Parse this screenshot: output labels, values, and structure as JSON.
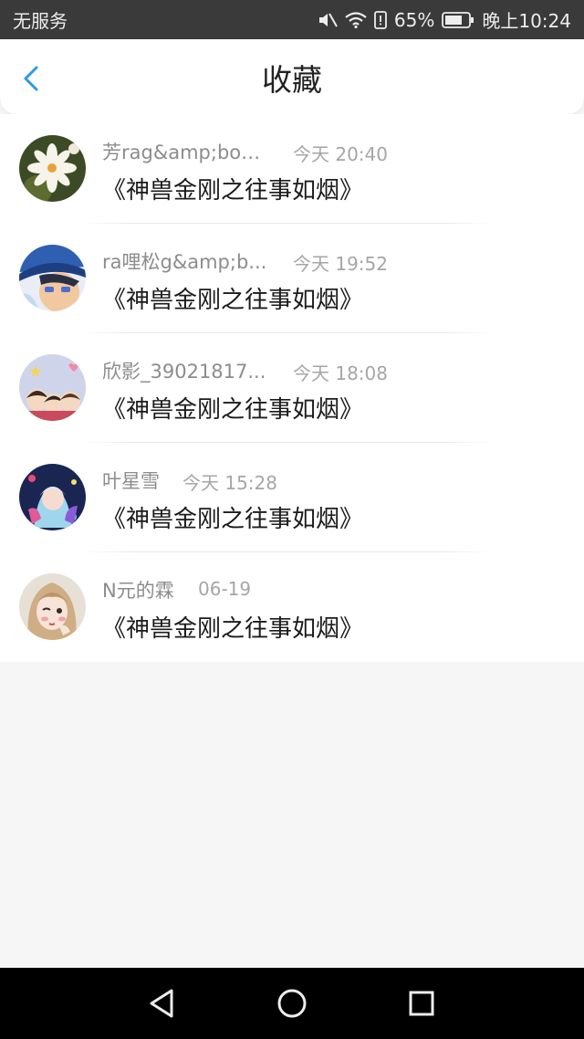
{
  "status_bar": {
    "carrier": "无服务",
    "battery": "65%",
    "time": "晚上10:24"
  },
  "header": {
    "title": "收藏"
  },
  "items": [
    {
      "name": "芳rag&amp;bon...",
      "time": "今天 20:40",
      "title": "《神兽金刚之往事如烟》",
      "avatar": "flower-avatar"
    },
    {
      "name": "ra哩松g&amp;b...",
      "time": "今天 19:52",
      "title": "《神兽金刚之往事如烟》",
      "avatar": "anime-boy-avatar"
    },
    {
      "name": "欣影_39021817...",
      "time": "今天 18:08",
      "title": "《神兽金刚之往事如烟》",
      "avatar": "cartoon-group-avatar"
    },
    {
      "name": "叶星雪",
      "time": "今天 15:28",
      "title": "《神兽金刚之往事如烟》",
      "avatar": "anime-girl-avatar"
    },
    {
      "name": "N元的霖",
      "time": "06-19",
      "title": "《神兽金刚之往事如烟》",
      "avatar": "drawn-girl-avatar"
    }
  ],
  "colors": {
    "accent": "#2a9ae8",
    "status_bar": "#3a3a3a",
    "background": "#f7f6f7"
  },
  "nav": {
    "back": "back-triangle-icon",
    "home": "home-circle-icon",
    "recents": "recents-square-icon"
  }
}
